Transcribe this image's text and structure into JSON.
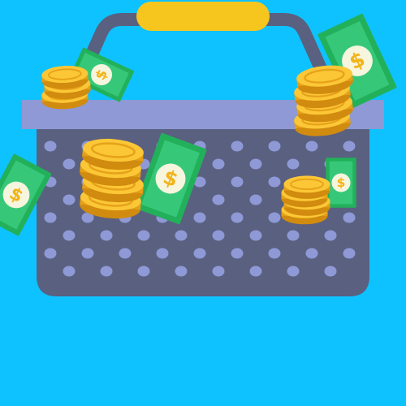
{
  "scene": {
    "name": "shopping-basket-with-money",
    "colors": {
      "background": "#0ec2ff",
      "basket_body": "#5a6080",
      "basket_rim": "#8e99d6",
      "basket_dots": "#8e99d6",
      "handle": "#5a6080",
      "handle_grip": "#f6c61e",
      "bill_dark_green": "#22b05a",
      "bill_light_green": "#33c875",
      "bill_inner": "#2aa65e",
      "bill_coin_face": "#f6f5de",
      "dollar_sign": "#f2b418",
      "coin_face": "#fcc736",
      "coin_edge": "#e09a12",
      "coin_shadow": "#cf8a10"
    },
    "icons": [
      "shopping-basket-icon",
      "dollar-bill-icon",
      "gold-coin-stack-icon"
    ],
    "counts": {
      "bills": 5,
      "coin_stacks": 4
    }
  }
}
